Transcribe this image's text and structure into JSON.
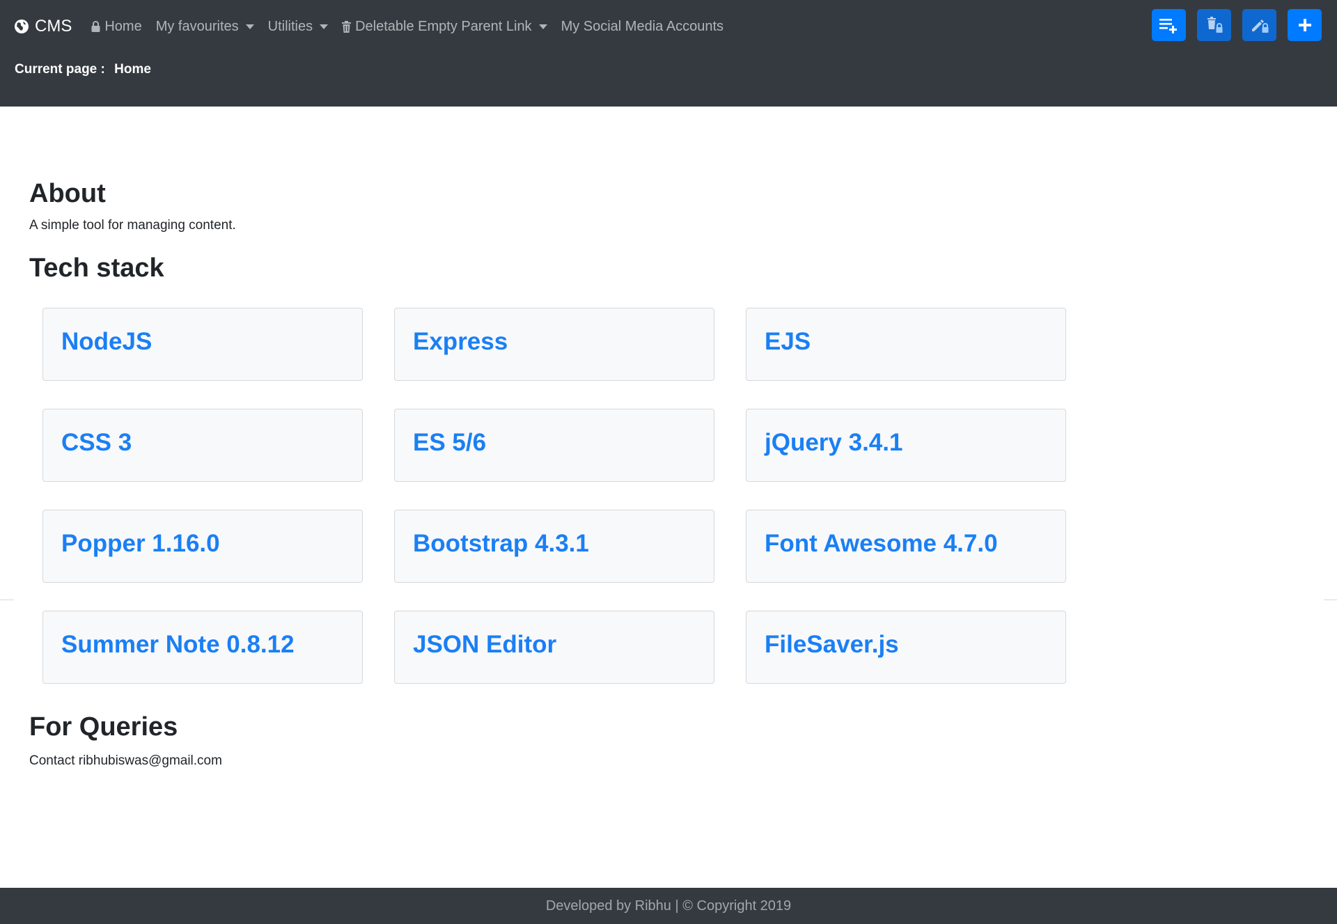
{
  "navbar": {
    "brand": "CMS",
    "links": [
      {
        "label": "Home",
        "icon": "lock-icon",
        "dropdown": false
      },
      {
        "label": "My favourites",
        "dropdown": true
      },
      {
        "label": "Utilities",
        "dropdown": true
      },
      {
        "label": "Deletable Empty Parent Link",
        "icon": "trash-icon",
        "dropdown": true
      },
      {
        "label": "My Social Media Accounts",
        "dropdown": false
      }
    ],
    "actions": [
      {
        "name": "add-page-button",
        "icon": "list-plus-icon"
      },
      {
        "name": "delete-locked-button",
        "icon": "trash-lock-icon"
      },
      {
        "name": "edit-locked-button",
        "icon": "pencil-lock-icon"
      },
      {
        "name": "add-button",
        "icon": "plus-icon"
      }
    ],
    "current_page_label": "Current page :",
    "current_page_value": "Home"
  },
  "about": {
    "heading": "About",
    "text": "A simple tool for managing content."
  },
  "tech_stack": {
    "heading": "Tech stack",
    "items": [
      "NodeJS",
      "Express",
      "EJS",
      "CSS 3",
      "ES 5/6",
      "jQuery 3.4.1",
      "Popper 1.16.0",
      "Bootstrap 4.3.1",
      "Font Awesome 4.7.0",
      "Summer Note 0.8.12",
      "JSON Editor",
      "FileSaver.js"
    ]
  },
  "queries": {
    "heading": "For Queries",
    "text": "Contact ribhubiswas@gmail.com"
  },
  "footer": {
    "text": "Developed by Ribhu | © Copyright 2019"
  },
  "colors": {
    "navbar_bg": "#343a40",
    "accent": "#007bff",
    "card_bg": "#f8f9fa",
    "card_text": "#1a7ff5"
  }
}
